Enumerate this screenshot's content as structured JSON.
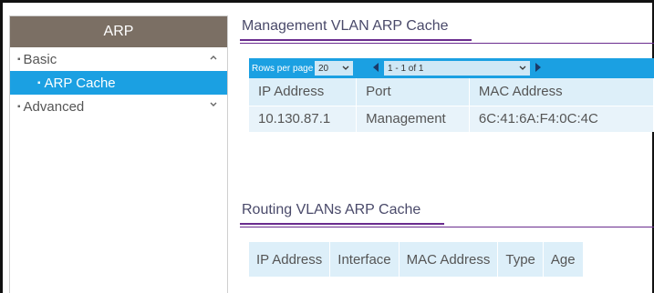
{
  "sidebar": {
    "header": "ARP",
    "items": [
      {
        "label": "Basic",
        "expanded": true,
        "chevron": "chevron-up-icon"
      },
      {
        "label": "ARP Cache",
        "active": true
      },
      {
        "label": "Advanced",
        "expanded": false,
        "chevron": "chevron-down-icon"
      }
    ]
  },
  "management": {
    "title": "Management VLAN ARP Cache",
    "pager": {
      "rows_per_page_label": "Rows per page",
      "rows_per_page_value": "20",
      "range_value": "1 - 1 of 1"
    },
    "columns": [
      "IP Address",
      "Port",
      "MAC Address"
    ],
    "rows": [
      [
        "10.130.87.1",
        "Management",
        "6C:41:6A:F4:0C:4C"
      ]
    ]
  },
  "routing": {
    "title": "Routing VLANs ARP Cache",
    "columns": [
      "IP Address",
      "Interface",
      "MAC Address",
      "Type",
      "Age"
    ]
  },
  "colors": {
    "accent_blue": "#1ba0e2",
    "header_brown": "#7b6f64",
    "rule_purple": "#6a2c8e"
  }
}
